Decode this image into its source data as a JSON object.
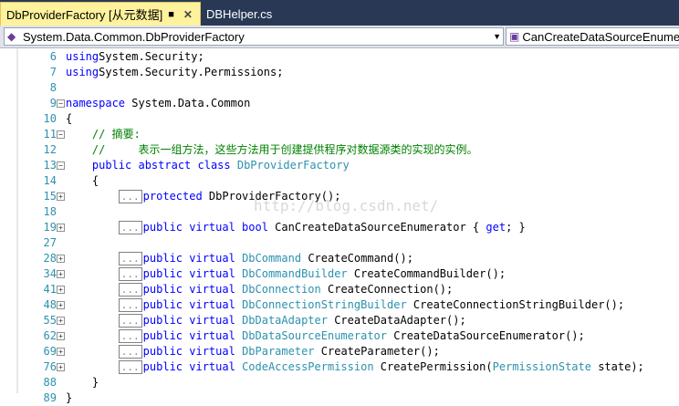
{
  "tabs": [
    {
      "label": "DbProviderFactory [从元数据]",
      "active": true
    },
    {
      "label": "DBHelper.cs",
      "active": false
    }
  ],
  "nav": {
    "left": "System.Data.Common.DbProviderFactory",
    "right": "CanCreateDataSourceEnumer"
  },
  "watermark": "http://blog.csdn.net/",
  "lines": [
    {
      "n": "6",
      "t": [
        [
          "kw",
          "using"
        ],
        [
          "",
          "System.Security;"
        ]
      ]
    },
    {
      "n": "7",
      "t": [
        [
          "kw",
          "using"
        ],
        [
          "",
          "System.Security.Permissions;"
        ]
      ]
    },
    {
      "n": "8",
      "t": []
    },
    {
      "n": "9",
      "fold": "-",
      "t": [
        [
          "kw",
          "namespace"
        ],
        [
          "",
          " System.Data.Common"
        ]
      ]
    },
    {
      "n": "10",
      "t": [
        [
          "",
          "{"
        ]
      ]
    },
    {
      "n": "11",
      "fold": "-",
      "t": [
        [
          "cm",
          "    // 摘要:"
        ]
      ]
    },
    {
      "n": "12",
      "t": [
        [
          "cm",
          "    //     表示一组方法，这些方法用于创建提供程序对数据源类的实现的实例。"
        ]
      ]
    },
    {
      "n": "13",
      "fold": "-",
      "t": [
        [
          "kw",
          "    public abstract class "
        ],
        [
          "ty",
          "DbProviderFactory"
        ]
      ]
    },
    {
      "n": "14",
      "t": [
        [
          "",
          "    {"
        ]
      ]
    },
    {
      "n": "15",
      "fold": "+",
      "t": [
        [
          "",
          "        "
        ],
        [
          "box",
          "..."
        ],
        [
          "kw",
          "protected"
        ],
        [
          "",
          " DbProviderFactory();"
        ]
      ]
    },
    {
      "n": "18",
      "t": []
    },
    {
      "n": "19",
      "fold": "+",
      "t": [
        [
          "",
          "        "
        ],
        [
          "box",
          "..."
        ],
        [
          "kw",
          "public virtual bool"
        ],
        [
          "",
          " CanCreateDataSourceEnumerator { "
        ],
        [
          "kw",
          "get"
        ],
        [
          "",
          "; }"
        ]
      ]
    },
    {
      "n": "27",
      "t": []
    },
    {
      "n": "28",
      "fold": "+",
      "t": [
        [
          "",
          "        "
        ],
        [
          "box",
          "..."
        ],
        [
          "kw",
          "public virtual"
        ],
        [
          "",
          " "
        ],
        [
          "ty",
          "DbCommand"
        ],
        [
          "",
          " CreateCommand();"
        ]
      ]
    },
    {
      "n": "34",
      "fold": "+",
      "t": [
        [
          "",
          "        "
        ],
        [
          "box",
          "..."
        ],
        [
          "kw",
          "public virtual"
        ],
        [
          "",
          " "
        ],
        [
          "ty",
          "DbCommandBuilder"
        ],
        [
          "",
          " CreateCommandBuilder();"
        ]
      ]
    },
    {
      "n": "41",
      "fold": "+",
      "t": [
        [
          "",
          "        "
        ],
        [
          "box",
          "..."
        ],
        [
          "kw",
          "public virtual"
        ],
        [
          "",
          " "
        ],
        [
          "ty",
          "DbConnection"
        ],
        [
          "",
          " CreateConnection();"
        ]
      ]
    },
    {
      "n": "48",
      "fold": "+",
      "t": [
        [
          "",
          "        "
        ],
        [
          "box",
          "..."
        ],
        [
          "kw",
          "public virtual"
        ],
        [
          "",
          " "
        ],
        [
          "ty",
          "DbConnectionStringBuilder"
        ],
        [
          "",
          " CreateConnectionStringBuilder();"
        ]
      ]
    },
    {
      "n": "55",
      "fold": "+",
      "t": [
        [
          "",
          "        "
        ],
        [
          "box",
          "..."
        ],
        [
          "kw",
          "public virtual"
        ],
        [
          "",
          " "
        ],
        [
          "ty",
          "DbDataAdapter"
        ],
        [
          "",
          " CreateDataAdapter();"
        ]
      ]
    },
    {
      "n": "62",
      "fold": "+",
      "t": [
        [
          "",
          "        "
        ],
        [
          "box",
          "..."
        ],
        [
          "kw",
          "public virtual"
        ],
        [
          "",
          " "
        ],
        [
          "ty",
          "DbDataSourceEnumerator"
        ],
        [
          "",
          " CreateDataSourceEnumerator();"
        ]
      ]
    },
    {
      "n": "69",
      "fold": "+",
      "t": [
        [
          "",
          "        "
        ],
        [
          "box",
          "..."
        ],
        [
          "kw",
          "public virtual"
        ],
        [
          "",
          " "
        ],
        [
          "ty",
          "DbParameter"
        ],
        [
          "",
          " CreateParameter();"
        ]
      ]
    },
    {
      "n": "76",
      "fold": "+",
      "t": [
        [
          "",
          "        "
        ],
        [
          "box",
          "..."
        ],
        [
          "kw",
          "public virtual"
        ],
        [
          "",
          " "
        ],
        [
          "ty",
          "CodeAccessPermission"
        ],
        [
          "",
          " CreatePermission("
        ],
        [
          "ty",
          "PermissionState"
        ],
        [
          "",
          " state);"
        ]
      ]
    },
    {
      "n": "88",
      "t": [
        [
          "",
          "    }"
        ]
      ]
    },
    {
      "n": "89",
      "t": [
        [
          "",
          "}"
        ]
      ]
    }
  ]
}
